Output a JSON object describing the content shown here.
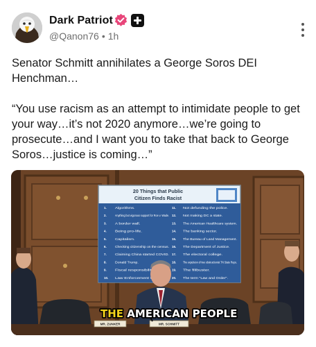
{
  "post": {
    "author": {
      "display_name": "Dark Patriot",
      "handle": "@Qanon76",
      "separator": "•",
      "time_ago": "1h",
      "avatar_icon": "eagle-avatar",
      "verified_badge_color": "#e8467a"
    },
    "text": {
      "paragraph_1": "Senator Schmitt annihilates a George Soros DEI Henchman…",
      "paragraph_2": "“You use racism as an attempt to intimidate people to get your way…it’s not 2020 anymore…we’re going to prosecute…and I want you to take that back to George Soros…justice is coming…”"
    },
    "media": {
      "sign_title_line1": "20 Things that Public",
      "sign_title_line2": "Citizen Finds Racist",
      "sign_items_left": [
        "Algorithms.",
        "Anything but vigorous support for Roe v. Wade.",
        "A border wall.",
        "Being pro-life.",
        "Capitalism.",
        "Checking citizenship on the census.",
        "Claiming China started COVID.",
        "Donald Trump.",
        "Fiscal responsibility.",
        "Law Enforcement writ large."
      ],
      "sign_items_right": [
        "Not defunding the police.",
        "Not making DC a state.",
        "The American Healthcare system.",
        "The banking sector.",
        "The Bureau of Land Management.",
        "The Department of Justice.",
        "The electoral college.",
        "The expulsion of two obstructionist TN State Reps.",
        "The filibuster.",
        "The term \"Law and Order\"."
      ],
      "caption_highlight": "THE",
      "caption_rest": " AMERICAN PEOPLE",
      "nameplate_left": "MR. ZUNKER",
      "nameplate_right": "MR. SCHMITT"
    }
  }
}
